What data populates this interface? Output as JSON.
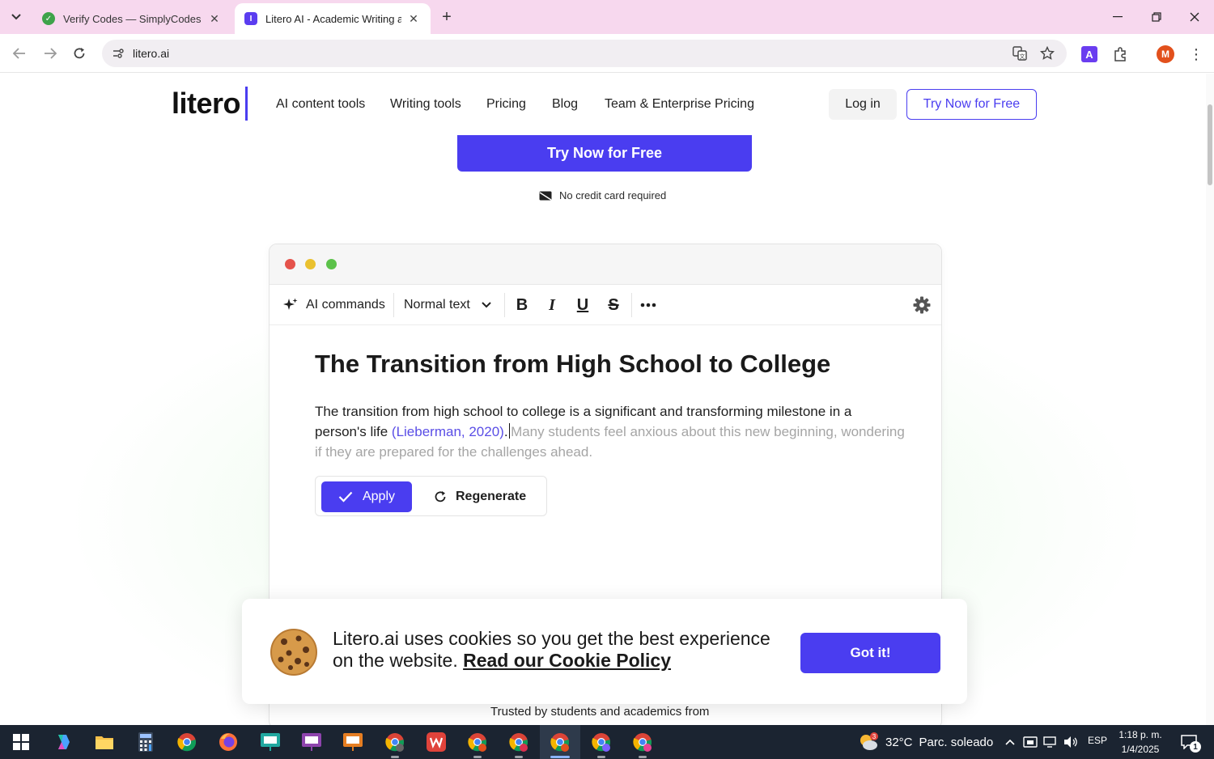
{
  "browser": {
    "tabs": [
      {
        "title": "Verify Codes — SimplyCodes",
        "active": false,
        "favicon_color": "#3ea34a"
      },
      {
        "title": "Litero AI - Academic Writing and",
        "active": true,
        "favicon_color": "#5b3df0"
      }
    ],
    "url": "litero.ai",
    "accent": "#f7d8ee",
    "profile_initial": "M"
  },
  "site": {
    "logo": "litero",
    "nav": [
      "AI content tools",
      "Writing tools",
      "Pricing",
      "Blog",
      "Team & Enterprise Pricing"
    ],
    "login_label": "Log in",
    "try_label": "Try Now for Free",
    "cta_label": "Try Now for Free",
    "no_card": "No credit card required",
    "brand_color": "#4a3df0"
  },
  "editor": {
    "ai_commands": "AI commands",
    "text_style": "Normal text",
    "format_buttons": [
      "B",
      "I",
      "U",
      "S"
    ],
    "doc_title": "The Transition from High School to College",
    "body_text": "The transition from high school to college is a significant and transforming milestone in a person's life ",
    "citation": "(Lieberman, 2020)",
    "period": ".",
    "suggestion": "Many students feel anxious about this new beginning, wondering if they are prepared for the challenges ahead.",
    "apply_label": "Apply",
    "regenerate_label": "Regenerate"
  },
  "cookie": {
    "text": "Litero.ai uses cookies so you get the best experience on the website. ",
    "policy_link": "Read our Cookie Policy",
    "button": "Got it!"
  },
  "trusted_text": "Trusted by students and academics from",
  "taskbar": {
    "weather_temp": "32°C",
    "weather_condition": "Parc. soleado",
    "weather_badge": "3",
    "language": "ESP",
    "time": "1:18 p. m.",
    "date": "1/4/2025",
    "notification_count": "1"
  }
}
